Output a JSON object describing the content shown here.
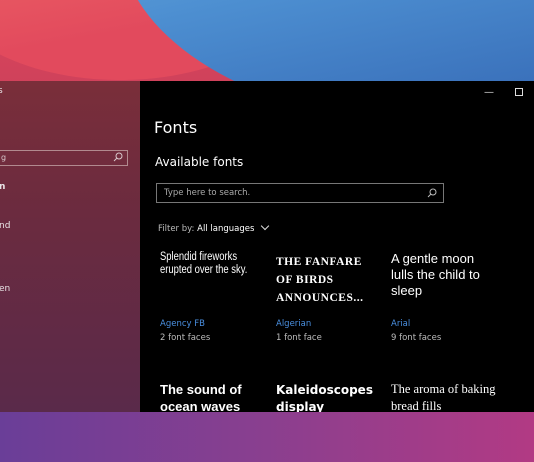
{
  "window": {
    "title": "Fonts",
    "minimize_glyph": "—",
    "nav": {
      "search_placeholder": "g",
      "items": [
        "n",
        "nd",
        "en"
      ]
    }
  },
  "main": {
    "section_title": "Available fonts",
    "search_placeholder": "Type here to search.",
    "filter_label": "Filter by:",
    "filter_value": "All languages",
    "fonts": [
      {
        "sample": "Splendid fireworks erupted over the sky.",
        "name": "Agency FB",
        "faces": "2 font faces"
      },
      {
        "sample": "THE FANFARE OF BIRDS ANNOUNCES...",
        "name": "Algerian",
        "faces": "1 font face"
      },
      {
        "sample": "A gentle moon lulls the child to sleep",
        "name": "Arial",
        "faces": "9 font faces"
      },
      {
        "sample": "The sound of ocean waves"
      },
      {
        "sample": "Kaleidoscopes display"
      },
      {
        "sample": "The aroma of baking bread fills"
      }
    ]
  },
  "colors": {
    "accent": "#4a8fe0",
    "background": "#000000"
  }
}
